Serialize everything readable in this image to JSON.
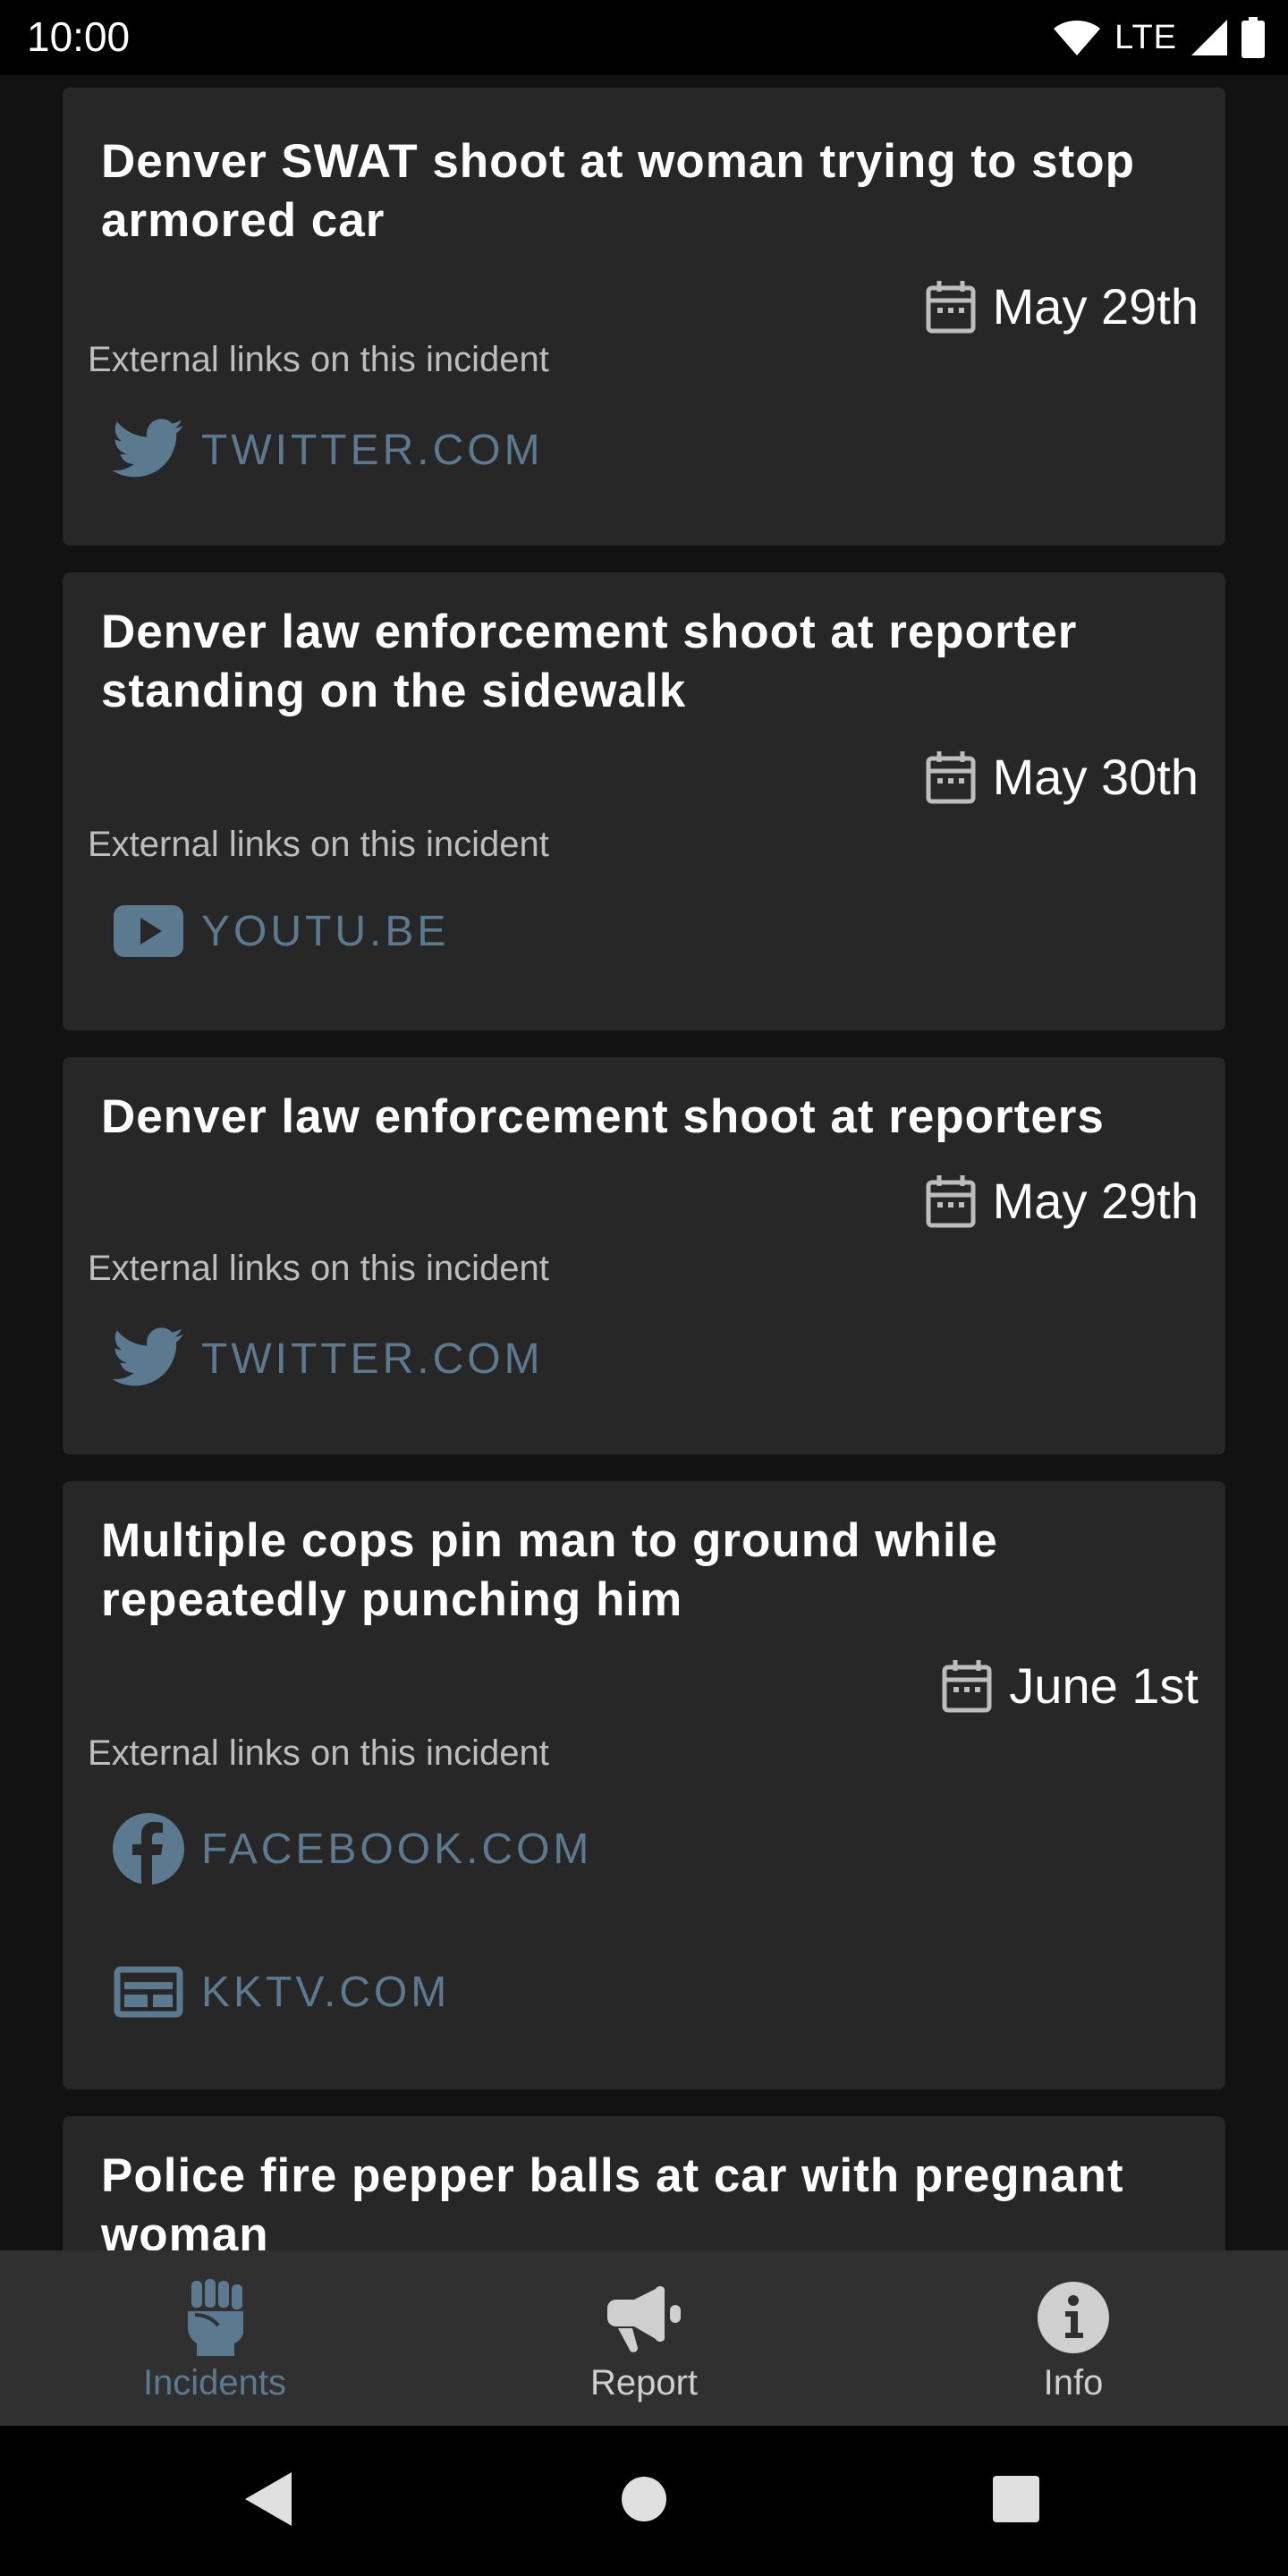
{
  "status_bar": {
    "time": "10:00",
    "network": "LTE"
  },
  "incidents": [
    {
      "title": "Denver SWAT shoot at woman trying to stop armored car",
      "date": "May 29th",
      "links_label": "External links on this incident",
      "links": [
        {
          "icon": "twitter-icon",
          "label": "TWITTER.COM"
        }
      ]
    },
    {
      "title": "Denver law enforcement shoot at reporter standing on the sidewalk",
      "date": "May 30th",
      "links_label": "External links on this incident",
      "links": [
        {
          "icon": "youtube-icon",
          "label": "YOUTU.BE"
        }
      ]
    },
    {
      "title": "Denver law enforcement shoot at reporters",
      "date": "May 29th",
      "links_label": "External links on this incident",
      "links": [
        {
          "icon": "twitter-icon",
          "label": "TWITTER.COM"
        }
      ]
    },
    {
      "title": "Multiple cops pin man to ground while repeatedly punching him",
      "date": "June 1st",
      "links_label": "External links on this incident",
      "links": [
        {
          "icon": "facebook-icon",
          "label": "FACEBOOK.COM"
        },
        {
          "icon": "news-icon",
          "label": "KKTV.COM"
        }
      ]
    },
    {
      "title": "Police fire pepper balls at car with pregnant woman"
    }
  ],
  "bottom_nav": {
    "items": [
      {
        "label": "Incidents",
        "icon": "fist-icon",
        "active": true
      },
      {
        "label": "Report",
        "icon": "megaphone-icon",
        "active": false
      },
      {
        "label": "Info",
        "icon": "info-icon",
        "active": false
      }
    ]
  },
  "colors": {
    "background": "#121212",
    "card": "#272727",
    "link": "#5c7a8f",
    "active_nav": "#5c7a8f",
    "inactive_nav": "#cfcfcf"
  }
}
